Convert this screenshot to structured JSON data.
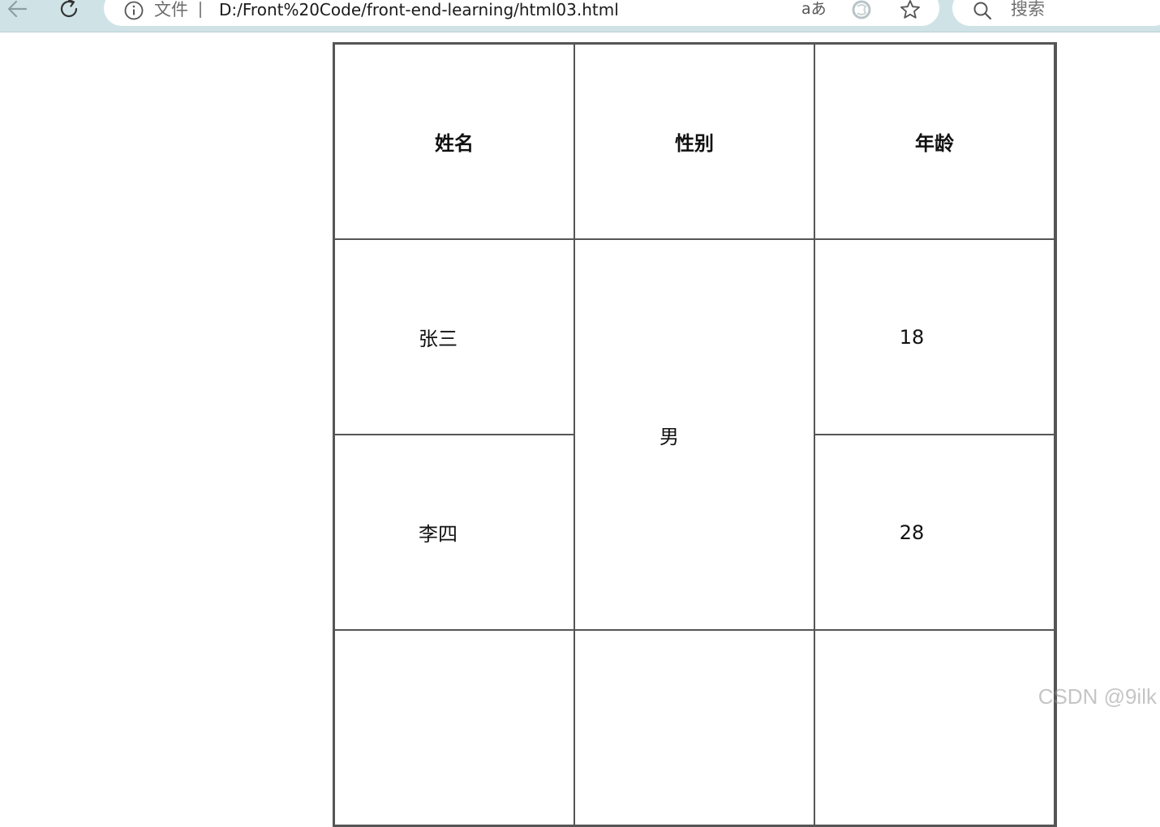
{
  "browser": {
    "address": {
      "scheme_label": "文件",
      "url": "D:/Front%20Code/front-end-learning/html03.html",
      "read_aloud_label": "aあ"
    },
    "search": {
      "placeholder": "搜索"
    }
  },
  "table": {
    "headers": [
      "姓名",
      "性别",
      "年龄"
    ],
    "rows": [
      {
        "name": "张三",
        "gender": "男",
        "age": "18"
      },
      {
        "name": "李四",
        "age": "28"
      }
    ]
  },
  "watermark": "CSDN @9ilk"
}
